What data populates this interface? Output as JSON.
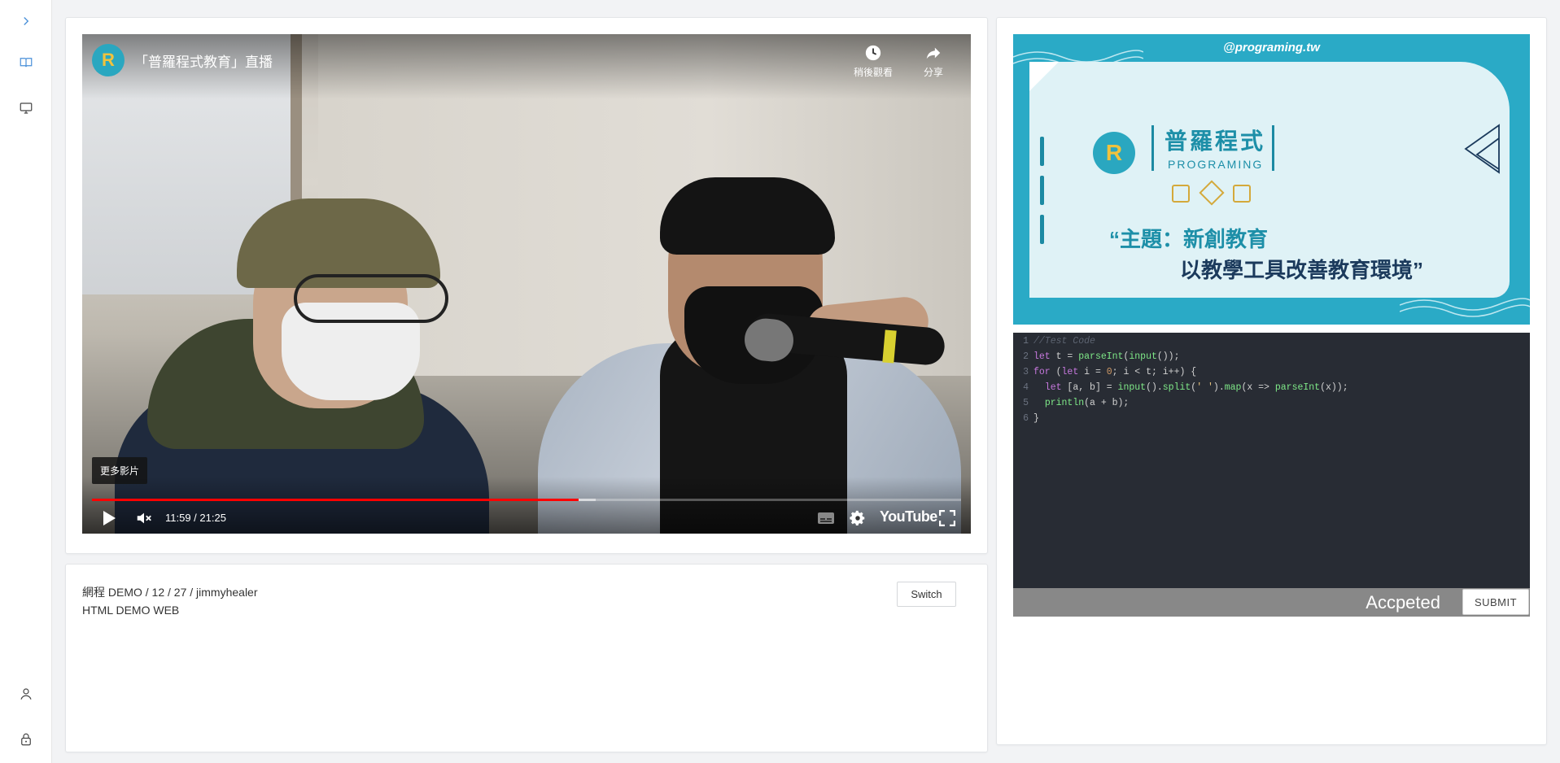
{
  "sidebar": {
    "items": [
      {
        "name": "expand-chevron-icon"
      },
      {
        "name": "book-icon"
      },
      {
        "name": "monitor-icon"
      },
      {
        "name": "user-icon"
      },
      {
        "name": "lock-icon"
      }
    ]
  },
  "video": {
    "channel_logo": "R",
    "title": "「普羅程式教育」直播",
    "watch_later_label": "稍後觀看",
    "share_label": "分享",
    "more_videos_label": "更多影片",
    "current_time": "11:59",
    "duration": "21:25",
    "time_display": "11:59 / 21:25",
    "progress_fraction": 0.56,
    "buffered_fraction": 0.58,
    "brand": "YouTube"
  },
  "info": {
    "breadcrumb": "網程 DEMO / 12 / 27 / jimmyhealer",
    "subtitle": "HTML DEMO WEB",
    "switch_label": "Switch"
  },
  "banner": {
    "handle": "@programing.tw",
    "logo_letter": "R",
    "brand_name": "普羅程式",
    "brand_sub": "PROGRAMING",
    "topic_line1": "“主題：新創教育",
    "topic_line2": "以教學工具改善教育環境”"
  },
  "editor": {
    "lines": [
      "//Test Code",
      "let t = parseInt(input());",
      "for (let i = 0; i < t; i++) {",
      "  let [a, b] = input().split(' ').map(x => parseInt(x));",
      "  println(a + b);",
      "}"
    ],
    "status": "Accpeted",
    "submit_label": "SUBMIT"
  },
  "colors": {
    "progress": "#ff0000",
    "banner_bg": "#2aaac6",
    "editor_bg": "#282c34",
    "submit_bar": "#888888"
  }
}
